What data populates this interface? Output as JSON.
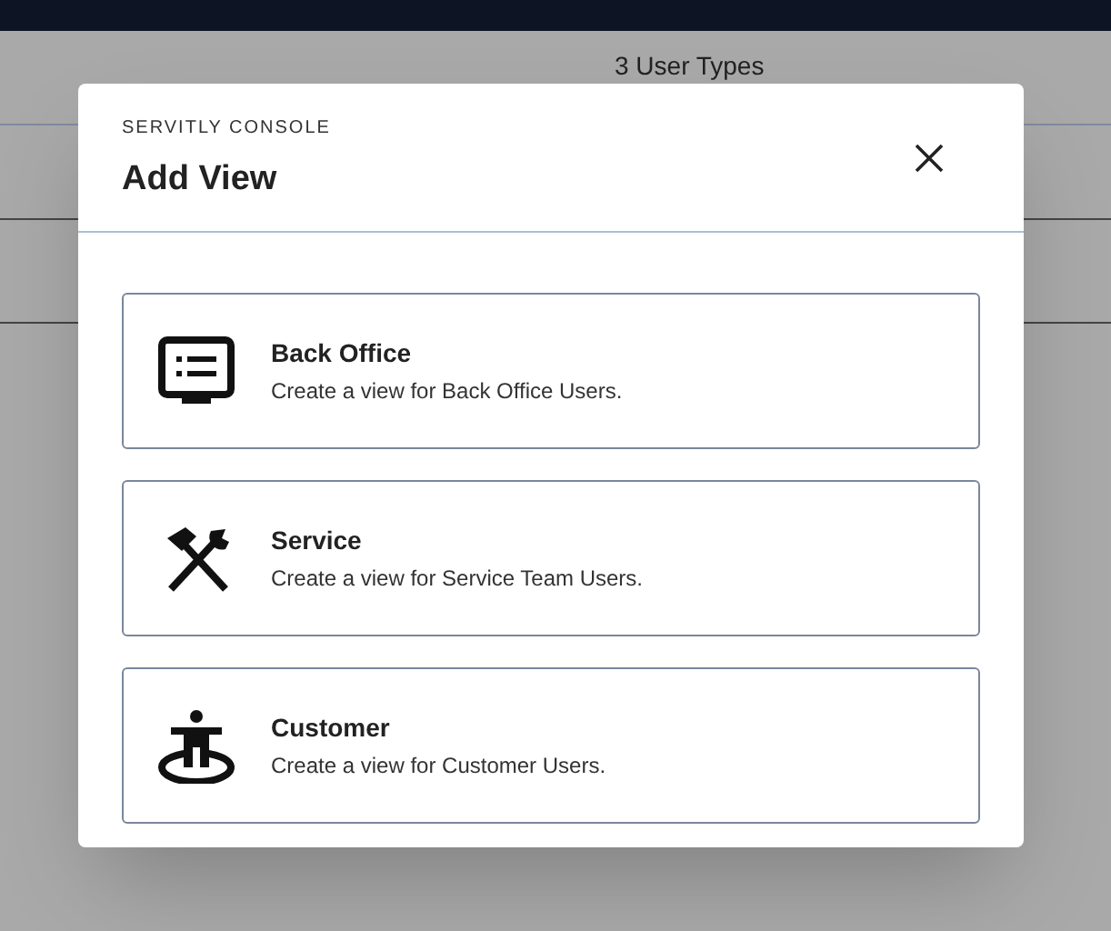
{
  "background": {
    "column_text": "3 User Types"
  },
  "dialog": {
    "subtitle": "SERVITLY CONSOLE",
    "title": "Add View"
  },
  "options": [
    {
      "kind": "monitor",
      "title": "Back Office",
      "description": "Create a view for Back Office Users."
    },
    {
      "kind": "tools",
      "title": "Service",
      "description": "Create a view for Service Team Users."
    },
    {
      "kind": "person",
      "title": "Customer",
      "description": "Create a view for Customer Users."
    }
  ]
}
